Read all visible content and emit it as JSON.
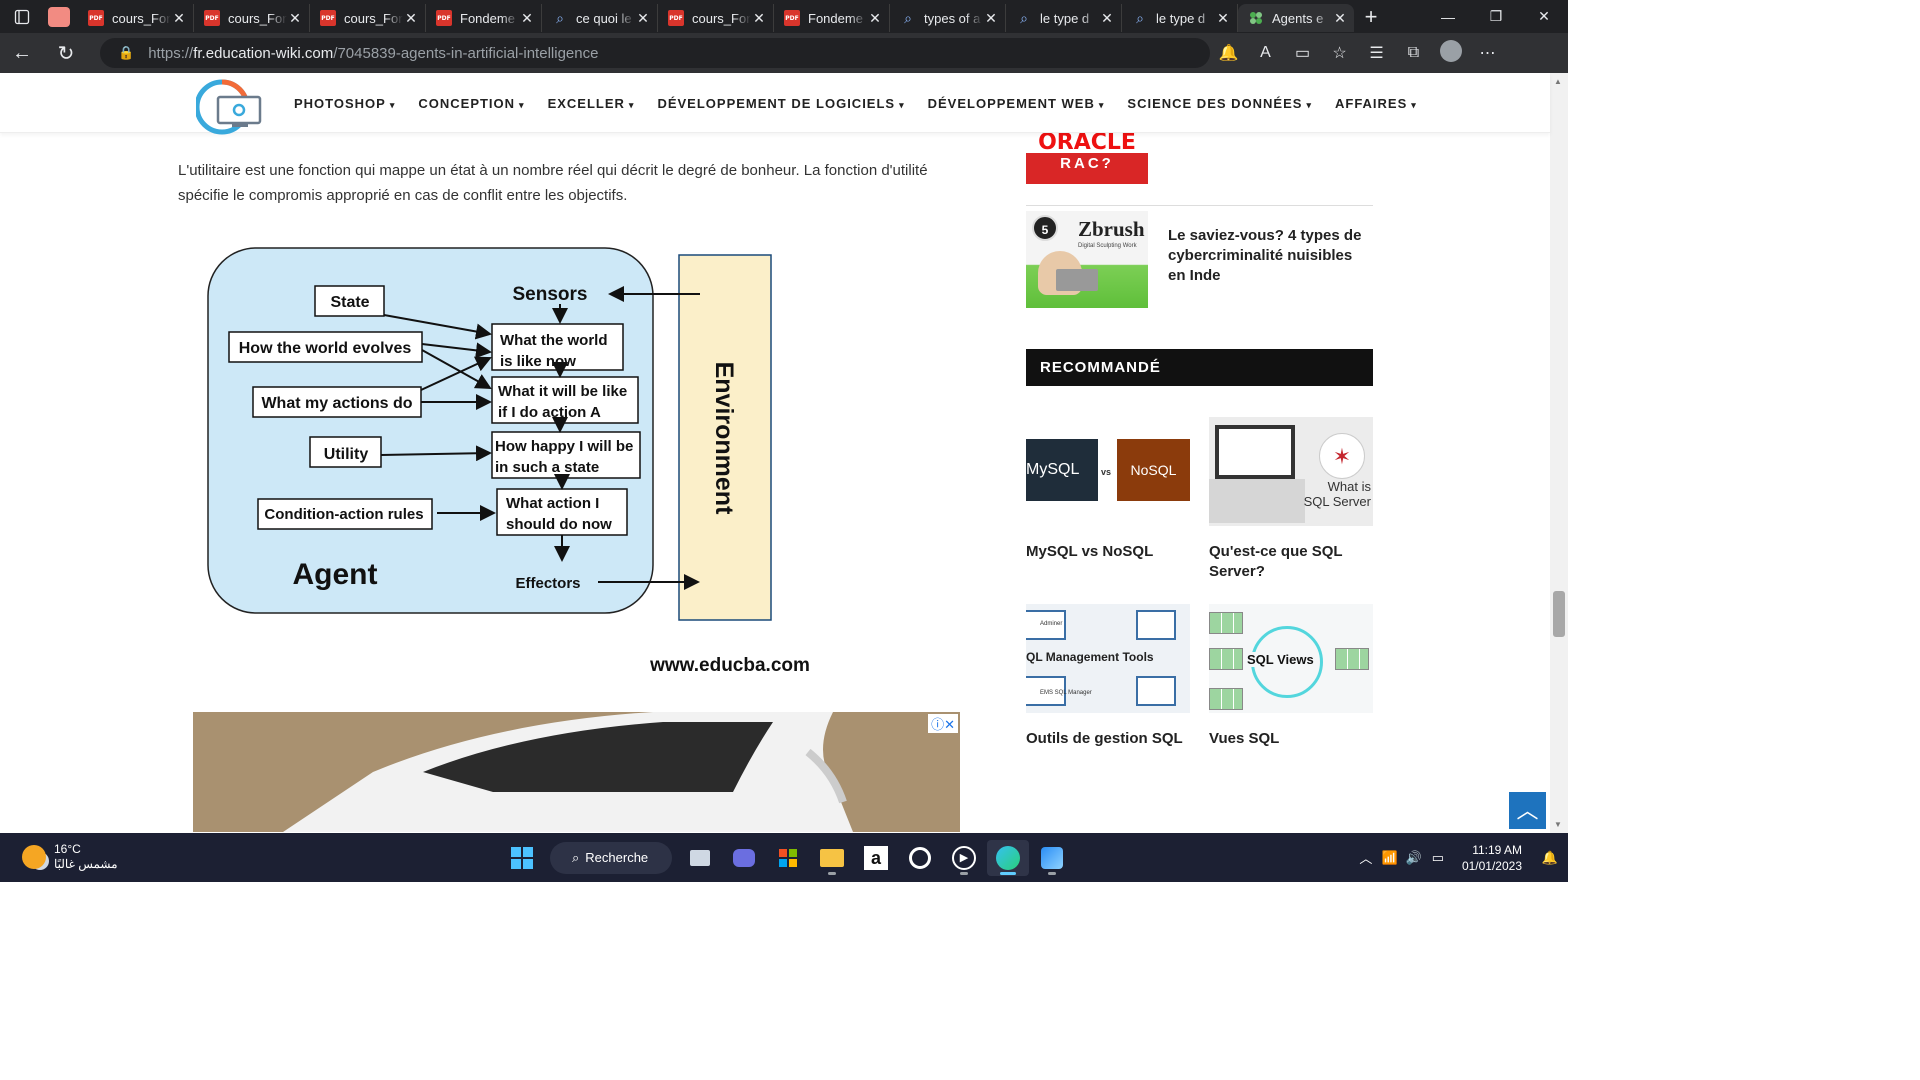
{
  "browser": {
    "tabs": [
      {
        "label": "cours_For",
        "icon": "pdf-icon"
      },
      {
        "label": "cours_For",
        "icon": "pdf-icon"
      },
      {
        "label": "cours_For",
        "icon": "pdf-icon"
      },
      {
        "label": "Fondeme",
        "icon": "pdf-icon"
      },
      {
        "label": "ce quoi le",
        "icon": "search-icon"
      },
      {
        "label": "cours_For",
        "icon": "pdf-icon"
      },
      {
        "label": "Fondeme",
        "icon": "pdf-icon"
      },
      {
        "label": "types of a",
        "icon": "search-icon"
      },
      {
        "label": "le type d",
        "icon": "search-icon"
      },
      {
        "label": "le type d",
        "icon": "search-icon"
      },
      {
        "label": "Agents e",
        "icon": "site-icon"
      }
    ],
    "url_prefix": "https://",
    "url_host": "fr.education-wiki.com",
    "url_path": "/7045839-agents-in-artificial-intelligence"
  },
  "site": {
    "nav": [
      {
        "label": "PHOTOSHOP"
      },
      {
        "label": "CONCEPTION"
      },
      {
        "label": "EXCELLER"
      },
      {
        "label": "DÉVELOPPEMENT DE LOGICIELS"
      },
      {
        "label": "DÉVELOPPEMENT WEB"
      },
      {
        "label": "SCIENCE DES DONNÉES"
      },
      {
        "label": "AFFAIRES"
      }
    ]
  },
  "article": {
    "paragraph": "L'utilitaire est une fonction qui mappe un état à un nombre réel qui décrit le degré de bonheur. La fonction d'utilité spécifie le compromis approprié en cas de conflit entre les objectifs.",
    "diagram": {
      "state": "State",
      "evolves": "How the world evolves",
      "actions": "What my actions do",
      "utility": "Utility",
      "rules": "Condition-action rules",
      "agent": "Agent",
      "sensors": "Sensors",
      "now_1": "What the world",
      "now_2": "is like now",
      "will_1": "What it will be like",
      "will_2": "if I do action A",
      "happy_1": "How happy I will be",
      "happy_2": "in such a state",
      "action_1": "What action I",
      "action_2": "should do now",
      "effectors": "Effectors",
      "environment": "Environment",
      "source": "www.educba.com"
    }
  },
  "sidebar": {
    "oracle_1": "ORACLE",
    "oracle_2": "RAC?",
    "post_num": "5",
    "post_thumb_title": "Zbrush",
    "post_thumb_sub": "Digital Sculpting Work",
    "post_title": "Le saviez-vous? 4 types de cybercriminalité nuisibles en Inde",
    "recommended_heading": "RECOMMANDÉ",
    "cards": [
      {
        "title": "MySQL vs NoSQL",
        "img_a": "MySQL",
        "img_vs": "vs",
        "img_b": "NoSQL"
      },
      {
        "title": "Qu'est-ce que SQL Server?",
        "img_text_1": "What is",
        "img_text_2": "SQL Server"
      },
      {
        "title": "Outils de gestion SQL",
        "img_text": "QL Management Tools",
        "img_small_1": "Adminer",
        "img_small_2": "EMS SQL Manager"
      },
      {
        "title": "Vues SQL",
        "img_text": "SQL Views"
      }
    ]
  },
  "taskbar": {
    "temp": "16°C",
    "weather": "مشمس غالبًا",
    "search": "Recherche",
    "time": "11:19 AM",
    "date": "01/01/2023"
  },
  "colors": {
    "agent_fill": "#cde8f7",
    "environment_fill": "#fbefc9",
    "accent_blue": "#1e73be"
  }
}
